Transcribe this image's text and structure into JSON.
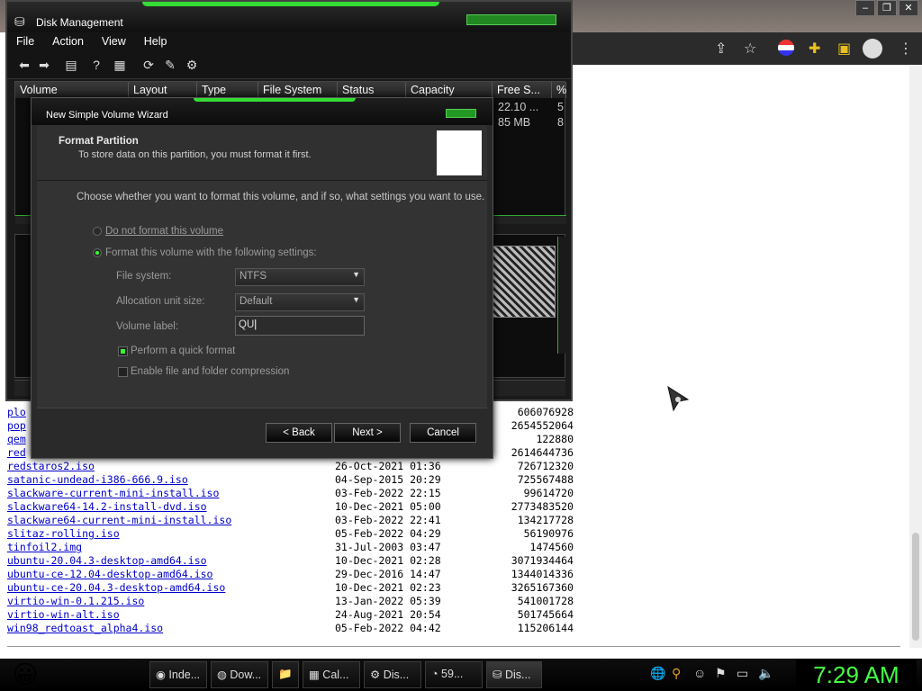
{
  "taskbar": {
    "start_icon": "smiley-icon",
    "tasks": [
      {
        "label": "Inde...",
        "icon": "chrome-icon"
      },
      {
        "label": "Dow...",
        "icon": "firefox-icon"
      },
      {
        "label": "",
        "icon": "folder-icon"
      },
      {
        "label": "Cal...",
        "icon": "calculator-icon"
      },
      {
        "label": "Dis...",
        "icon": "gear-icon"
      },
      {
        "label": "59...",
        "icon": "disk-icon"
      },
      {
        "label": "Dis...",
        "icon": "disk-management-icon"
      }
    ],
    "clock": "7:29 AM"
  },
  "disk_management": {
    "title": "Disk Management",
    "menu": [
      "File",
      "Action",
      "View",
      "Help"
    ],
    "columns": [
      "Volume",
      "Layout",
      "Type",
      "File System",
      "Status",
      "Capacity",
      "Free S...",
      "%"
    ],
    "free_space": [
      "22.10 ...",
      "85 MB"
    ],
    "percent": [
      "5",
      "8"
    ]
  },
  "wizard": {
    "title": "New Simple Volume Wizard",
    "header_title": "Format Partition",
    "header_subtitle": "To store data on this partition, you must format it first.",
    "instruction": "Choose whether you want to format this volume, and if so, what settings you want to use.",
    "option_no_format": "Do not format this volume",
    "option_format": "Format this volume with the following settings:",
    "file_system_label": "File system:",
    "file_system_value": "NTFS",
    "allocation_label": "Allocation unit size:",
    "allocation_value": "Default",
    "volume_label_label": "Volume label:",
    "volume_label_value": "QU",
    "quick_format": "Perform a quick format",
    "compression": "Enable file and folder compression",
    "back": "< Back",
    "next": "Next >",
    "cancel": "Cancel"
  },
  "files": [
    {
      "name": "plo",
      "date": "",
      "size": "606076928"
    },
    {
      "name": "pop",
      "date": "",
      "size": "2654552064"
    },
    {
      "name": "qem",
      "date": "",
      "size": "122880"
    },
    {
      "name": "red",
      "date": "",
      "size": "2614644736"
    },
    {
      "name": "redstaros2.iso",
      "date": "26-Oct-2021 01:36",
      "size": "726712320"
    },
    {
      "name": "satanic-undead-i386-666.9.iso",
      "date": "04-Sep-2015 20:29",
      "size": "725567488"
    },
    {
      "name": "slackware-current-mini-install.iso",
      "date": "03-Feb-2022 22:15",
      "size": "99614720"
    },
    {
      "name": "slackware64-14.2-install-dvd.iso",
      "date": "10-Dec-2021 05:00",
      "size": "2773483520"
    },
    {
      "name": "slackware64-current-mini-install.iso",
      "date": "03-Feb-2022 22:41",
      "size": "134217728"
    },
    {
      "name": "slitaz-rolling.iso",
      "date": "05-Feb-2022 04:29",
      "size": "56190976"
    },
    {
      "name": "tinfoil2.img",
      "date": "31-Jul-2003 03:47",
      "size": "1474560"
    },
    {
      "name": "ubuntu-20.04.3-desktop-amd64.iso",
      "date": "10-Dec-2021 02:28",
      "size": "3071934464"
    },
    {
      "name": "ubuntu-ce-12.04-desktop-amd64.iso",
      "date": "29-Dec-2016 14:47",
      "size": "1344014336"
    },
    {
      "name": "ubuntu-ce-20.04.3-desktop-amd64.iso",
      "date": "10-Dec-2021 02:23",
      "size": "3265167360"
    },
    {
      "name": "virtio-win-0.1.215.iso",
      "date": "13-Jan-2022 05:39",
      "size": "541001728"
    },
    {
      "name": "virtio-win-alt.iso",
      "date": "24-Aug-2021 20:54",
      "size": "501745664"
    },
    {
      "name": "win98_redtoast_alpha4.iso",
      "date": "05-Feb-2022 04:42",
      "size": "115206144"
    }
  ]
}
